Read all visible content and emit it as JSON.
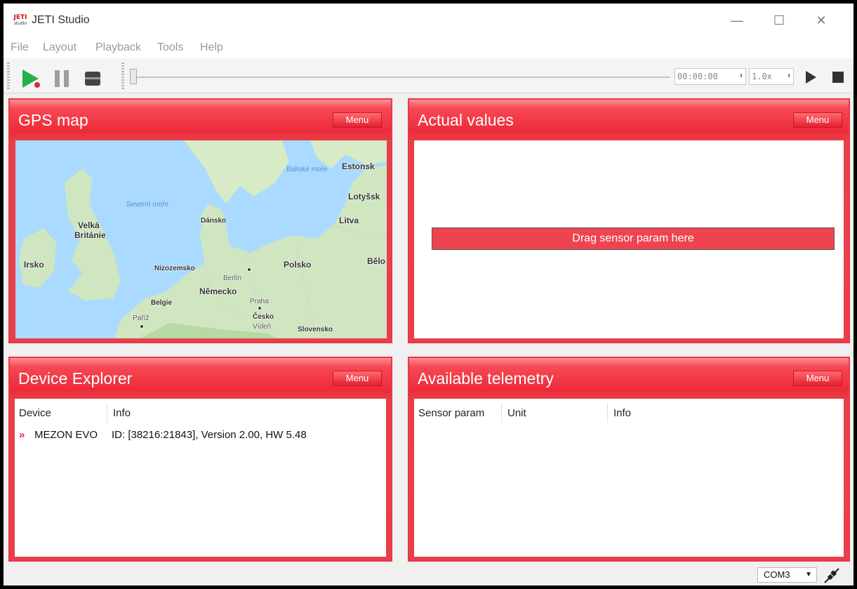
{
  "window": {
    "title": "JETI Studio",
    "logo_text": "JETI",
    "logo_subtext": "studio",
    "controls": {
      "minimize": "—",
      "maximize": "☐",
      "close": "✕"
    }
  },
  "menu": {
    "file": "File",
    "layout": "Layout",
    "playback": "Playback",
    "tools": "Tools",
    "help": "Help"
  },
  "toolbar": {
    "play_icon": "play-record-icon",
    "pause_icon": "pause-icon",
    "record_icon": "record-icon",
    "time_value": "00:00:00",
    "speed_value": "1.0x",
    "accent_green": "#22b14c",
    "accent_red": "#e02a36"
  },
  "panels": {
    "gps": {
      "title": "GPS map",
      "menu_label": "Menu",
      "map_labels": {
        "velka": "Velká",
        "britanie": "Británie",
        "irsko": "Irsko",
        "severni_more": "Severní moře",
        "dansko": "Dánsko",
        "baltske_more": "Baltské moře",
        "estonsk": "Estonsk",
        "lotyssk": "Lotyšsk",
        "litva": "Litva",
        "belo": "Bělo",
        "polsko": "Polsko",
        "nizozemsko": "Nizozemsko",
        "berlin": "Berlín",
        "nemecko": "Německo",
        "belgie": "Belgie",
        "pariz": "Paříž",
        "praha": "Praha",
        "cesko": "Česko",
        "viden": "Vídeň",
        "slovensko": "Slovensko"
      }
    },
    "values": {
      "title": "Actual values",
      "menu_label": "Menu",
      "drop_hint": "Drag sensor param here"
    },
    "device": {
      "title": "Device Explorer",
      "menu_label": "Menu",
      "columns": [
        "Device",
        "Info"
      ],
      "rows": [
        {
          "name": "MEZON EVO",
          "info": "ID: [38216:21843], Version  2.00, HW  5.48"
        }
      ]
    },
    "telemetry": {
      "title": "Available telemetry",
      "menu_label": "Menu",
      "columns": [
        "Sensor param",
        "Unit",
        "Info"
      ]
    }
  },
  "statusbar": {
    "port": "COM3",
    "connect_icon": "plug-disconnected-icon"
  },
  "colors": {
    "panel_red": "#ea3f4b",
    "panel_highlight": "#ff8f95",
    "map_water": "#aadaff",
    "map_land": "#cfe6c0"
  }
}
